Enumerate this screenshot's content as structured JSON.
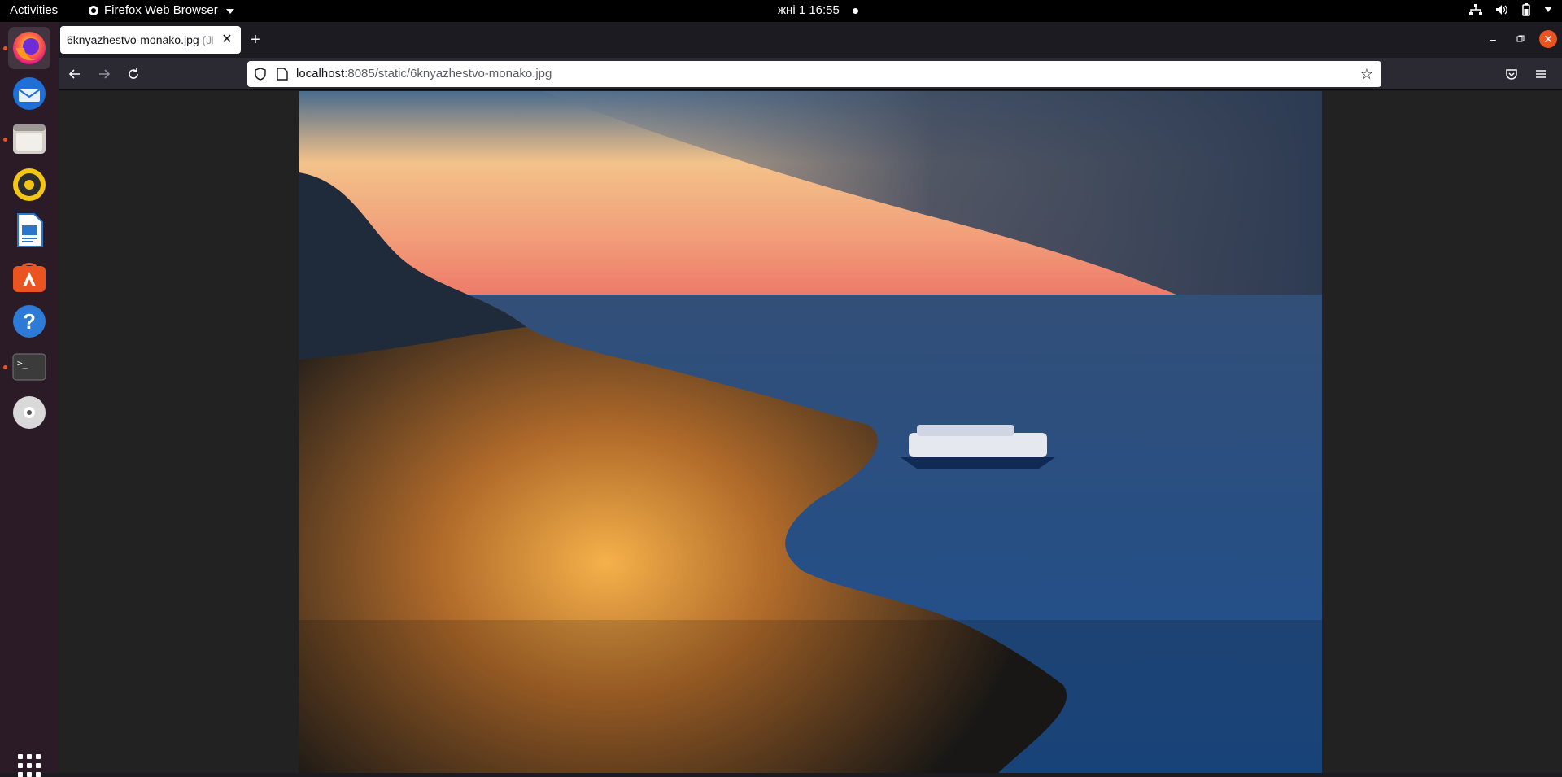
{
  "topbar": {
    "activities": "Activities",
    "app_name": "Firefox Web Browser",
    "clock": "жні 1  16:55"
  },
  "dock": {
    "items": [
      {
        "name": "firefox",
        "running": true,
        "active": true
      },
      {
        "name": "thunderbird",
        "running": false
      },
      {
        "name": "files",
        "running": true
      },
      {
        "name": "rhythmbox",
        "running": false
      },
      {
        "name": "libreoffice-writer",
        "running": false
      },
      {
        "name": "ubuntu-software",
        "running": false
      },
      {
        "name": "help",
        "running": false
      },
      {
        "name": "terminal",
        "running": true
      },
      {
        "name": "dvd",
        "running": false
      }
    ]
  },
  "browser": {
    "tab_title": "6knyazhestvo-monako.jpg",
    "tab_title_suffix": " (JPEG Image...",
    "url_host": "localhost",
    "url_rest": ":8085/static/6knyazhestvo-monako.jpg"
  },
  "image": {
    "subject": "Monaco at dusk: coastline city lights, sea, cruise ship, sunset sky"
  }
}
